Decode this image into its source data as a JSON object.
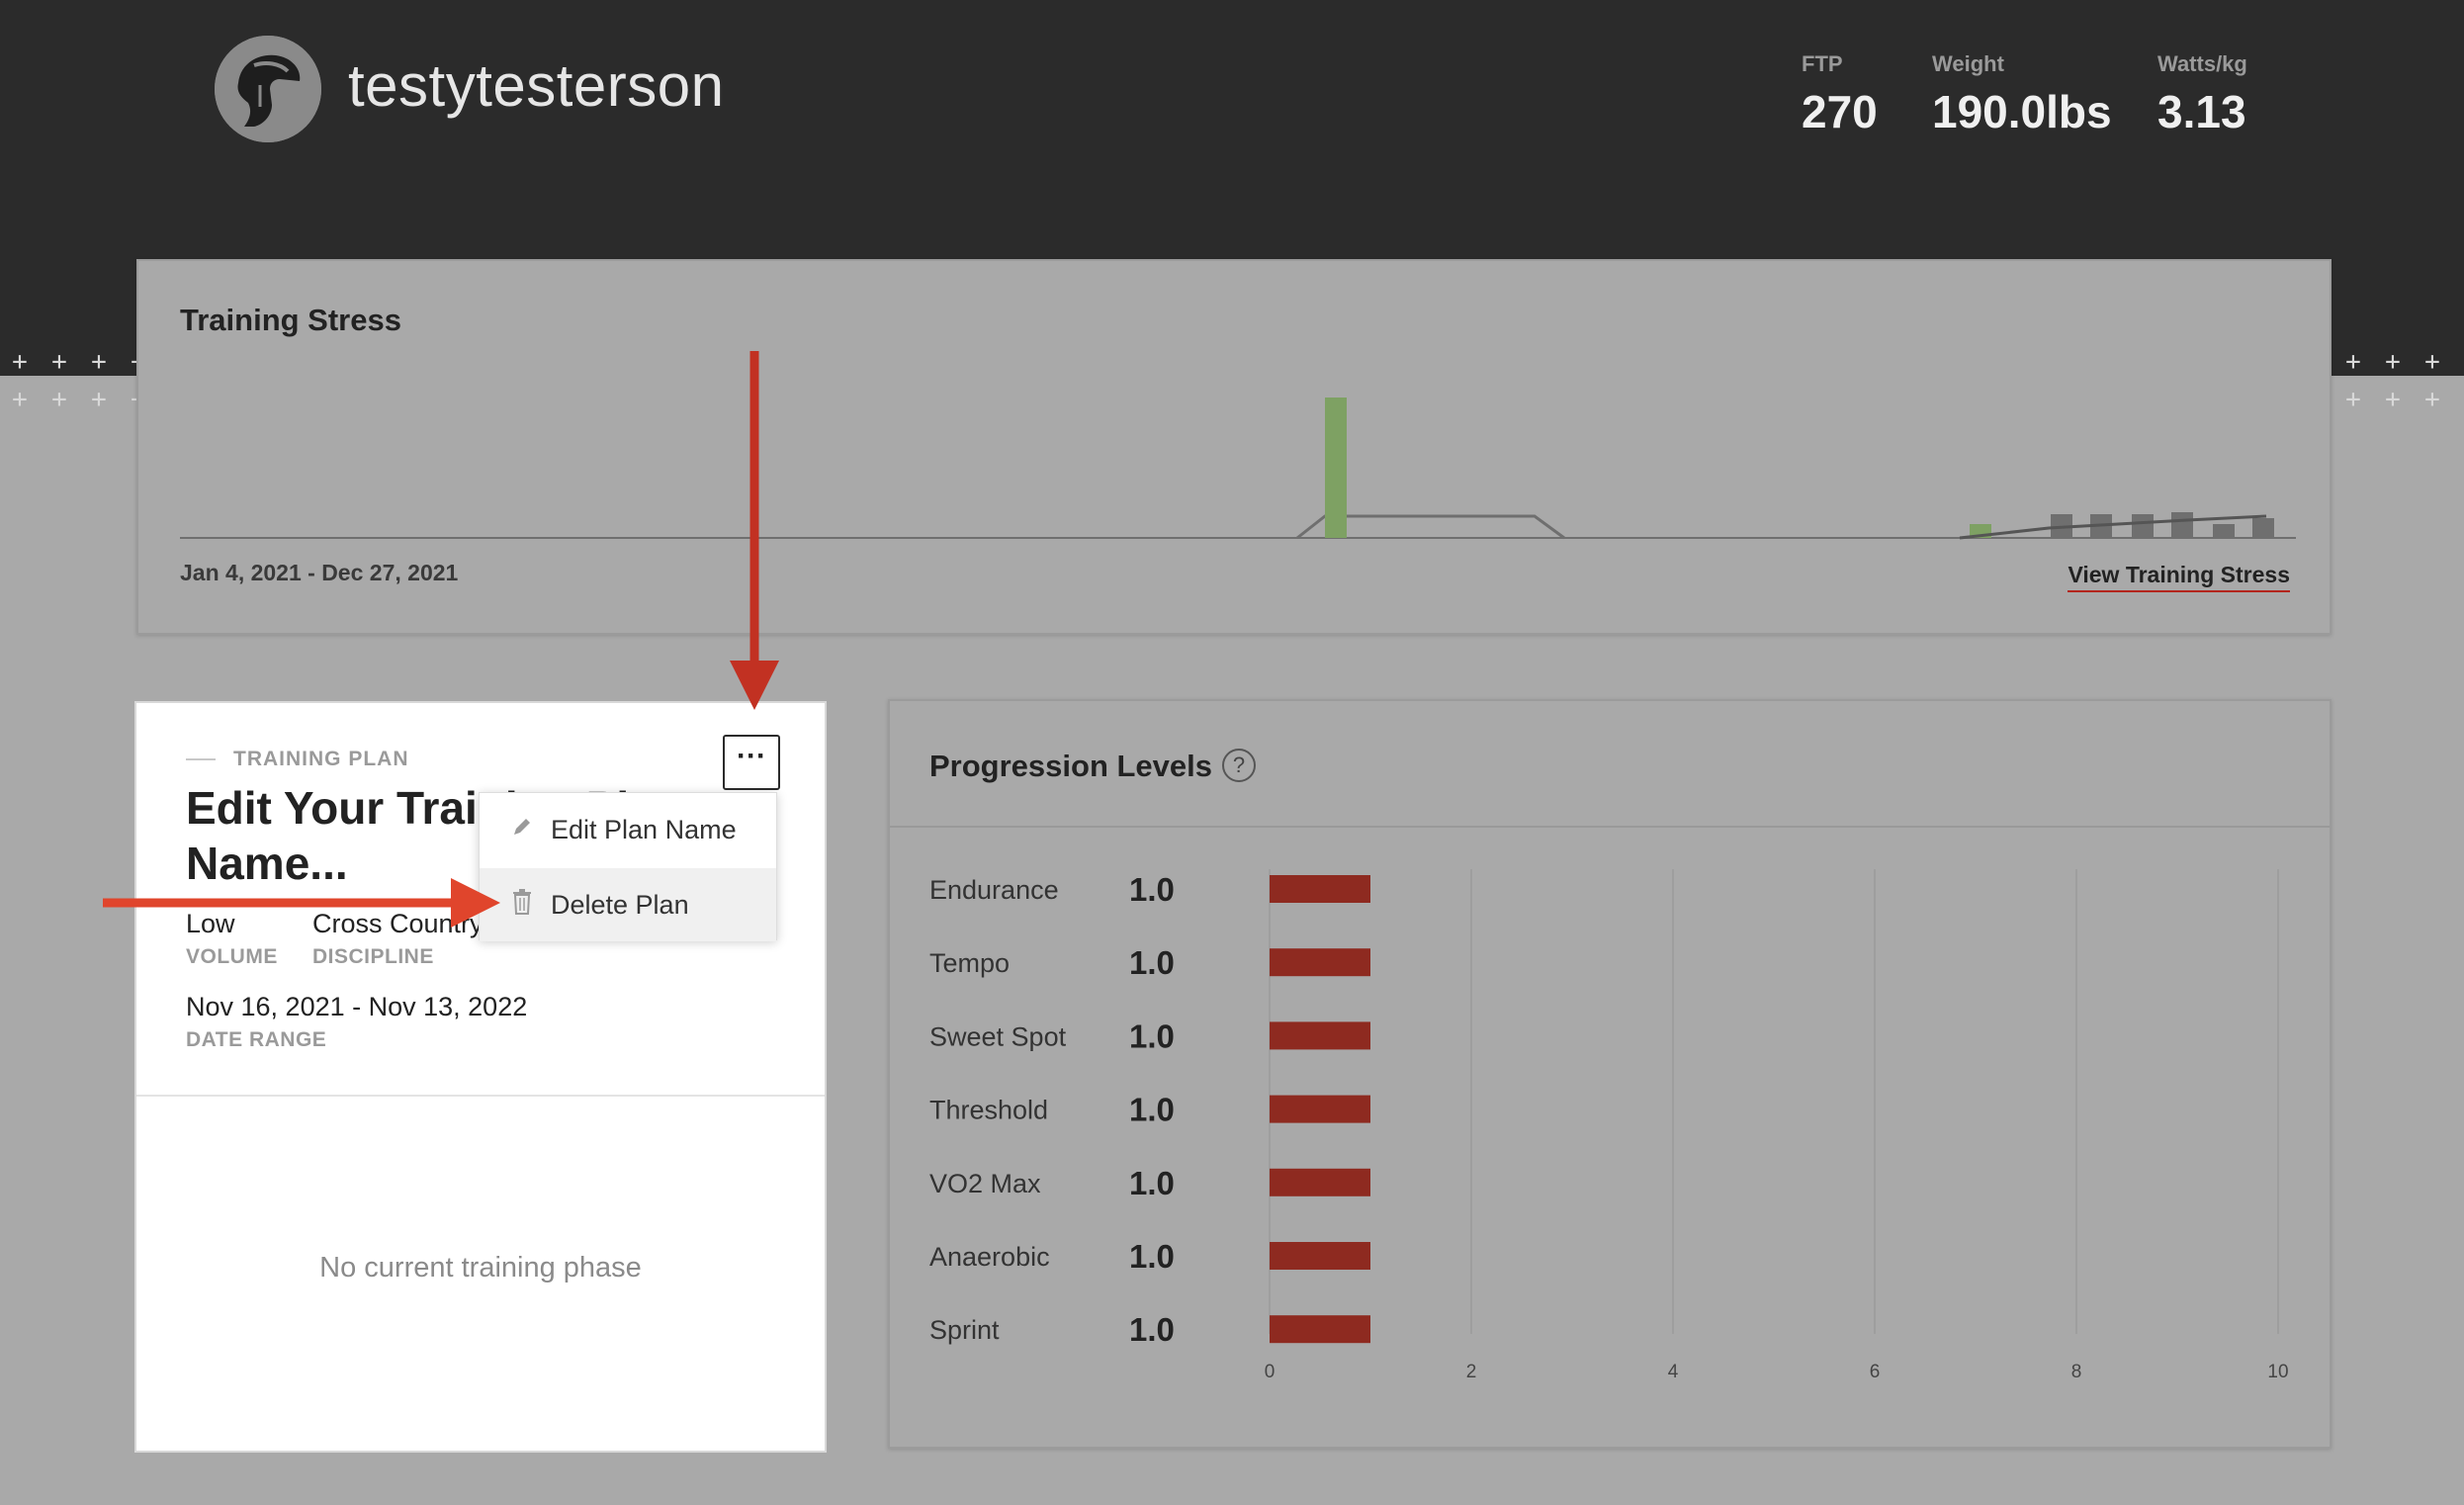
{
  "header": {
    "username": "testytesterson",
    "stats": [
      {
        "label": "FTP",
        "value": "270"
      },
      {
        "label": "Weight",
        "value": "190.0lbs"
      },
      {
        "label": "Watts/kg",
        "value": "3.13"
      }
    ]
  },
  "training_stress": {
    "title": "Training Stress",
    "date_range": "Jan 4, 2021 - Dec 27, 2021",
    "link": "View Training Stress"
  },
  "training_plan": {
    "eyebrow": "TRAINING PLAN",
    "title": "Edit Your Training Plan Name...",
    "volume_value": "Low",
    "volume_label": "VOLUME",
    "discipline_value": "Cross Country",
    "discipline_label": "DISCIPLINE",
    "date_range_value": "Nov 16, 2021 - Nov 13, 2022",
    "date_range_label": "DATE RANGE",
    "empty_phase": "No current training phase",
    "more_button": "···",
    "menu": {
      "edit_label": "Edit Plan Name",
      "delete_label": "Delete Plan"
    }
  },
  "progression": {
    "title": "Progression Levels",
    "help": "?"
  },
  "colors": {
    "bar_red": "#8e2a20",
    "arrow_red": "#c23122",
    "green_bar": "#7ea163",
    "gray_bar": "#6f6f6f"
  },
  "chart_data": [
    {
      "type": "bar",
      "title": "Progression Levels",
      "categories": [
        "Endurance",
        "Tempo",
        "Sweet Spot",
        "Threshold",
        "VO2 Max",
        "Anaerobic",
        "Sprint"
      ],
      "values": [
        1.0,
        1.0,
        1.0,
        1.0,
        1.0,
        1.0,
        1.0
      ],
      "value_labels": [
        "1.0",
        "1.0",
        "1.0",
        "1.0",
        "1.0",
        "1.0",
        "1.0"
      ],
      "xlim": [
        0,
        10
      ],
      "xticks": [
        "0",
        "2",
        "4",
        "6",
        "8",
        "10"
      ],
      "orientation": "horizontal",
      "grid": true
    }
  ]
}
